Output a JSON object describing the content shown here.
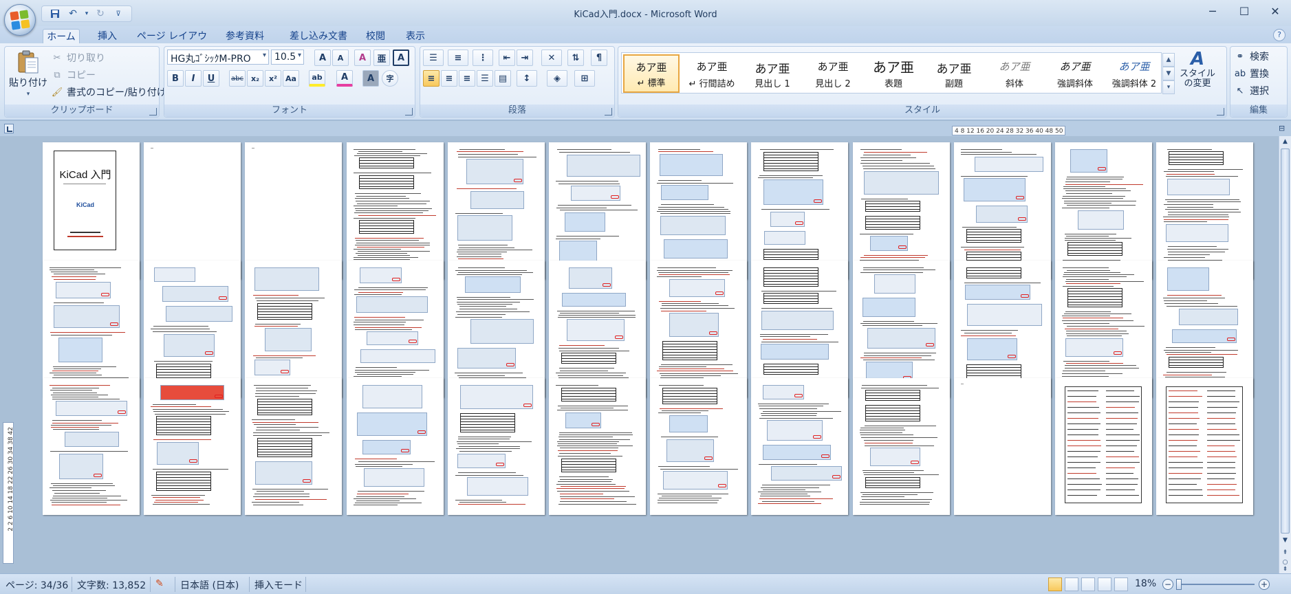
{
  "window": {
    "title": "KiCad入門.docx - Microsoft Word",
    "controls": [
      "─",
      "☐",
      "✕"
    ]
  },
  "qat": {
    "customize": "⊽"
  },
  "tabs": [
    "ホーム",
    "挿入",
    "ページ レイアウト",
    "参考資料",
    "差し込み文書",
    "校閲",
    "表示"
  ],
  "ribbon": {
    "clipboard": {
      "label": "クリップボード",
      "paste": "貼り付け",
      "cut": "切り取り",
      "copy": "コピー",
      "format_painter": "書式のコピー/貼り付け"
    },
    "font": {
      "label": "フォント",
      "font_name": "HG丸ｺﾞｼｯｸM-PRO",
      "font_size": "10.5",
      "grow": "A",
      "shrink": "A",
      "clear": "A",
      "ruby": "亜",
      "border_char": "A",
      "bold": "B",
      "italic": "I",
      "underline": "U",
      "strike": "abc",
      "subscript": "x₂",
      "superscript": "x²",
      "case": "Aa",
      "highlight": "ab",
      "font_color": "A",
      "shading_char": "A",
      "enclose": "字"
    },
    "paragraph": {
      "label": "段落"
    },
    "styles": {
      "label": "スタイル",
      "items": [
        {
          "sample": "あア亜",
          "name": "↵ 標準"
        },
        {
          "sample": "あア亜",
          "name": "↵ 行間詰め"
        },
        {
          "sample": "あア亜",
          "name": "見出し 1"
        },
        {
          "sample": "あア亜",
          "name": "見出し 2"
        },
        {
          "sample": "あア亜",
          "name": "表題"
        },
        {
          "sample": "あア亜",
          "name": "副題"
        },
        {
          "sample": "あア亜",
          "name": "斜体"
        },
        {
          "sample": "あア亜",
          "name": "強調斜体"
        },
        {
          "sample": "あア亜",
          "name": "強調斜体 2"
        }
      ],
      "change_styles": "スタイルの変更"
    },
    "editing": {
      "label": "編集",
      "find": "検索",
      "replace": "置換",
      "select": "選択"
    }
  },
  "ruler": {
    "horizontal": "4 8 12 16 20 24 28 32 36 40 48 50",
    "vertical": "2 2 6 10 14 18 22 26 30 34 38 42"
  },
  "document": {
    "title_page_heading": "KiCad 入門",
    "title_page_logo": "KiCad",
    "pages_total": 36
  },
  "status": {
    "page": "ページ: 34/36",
    "word_count": "文字数: 13,852",
    "language": "日本語 (日本)",
    "mode": "挿入モード",
    "zoom": "18%"
  },
  "colors": {
    "accent": "#15428b",
    "ribbon": "#dbe7f5",
    "background": "#a9bfd6",
    "selected": "#f8c85c"
  }
}
